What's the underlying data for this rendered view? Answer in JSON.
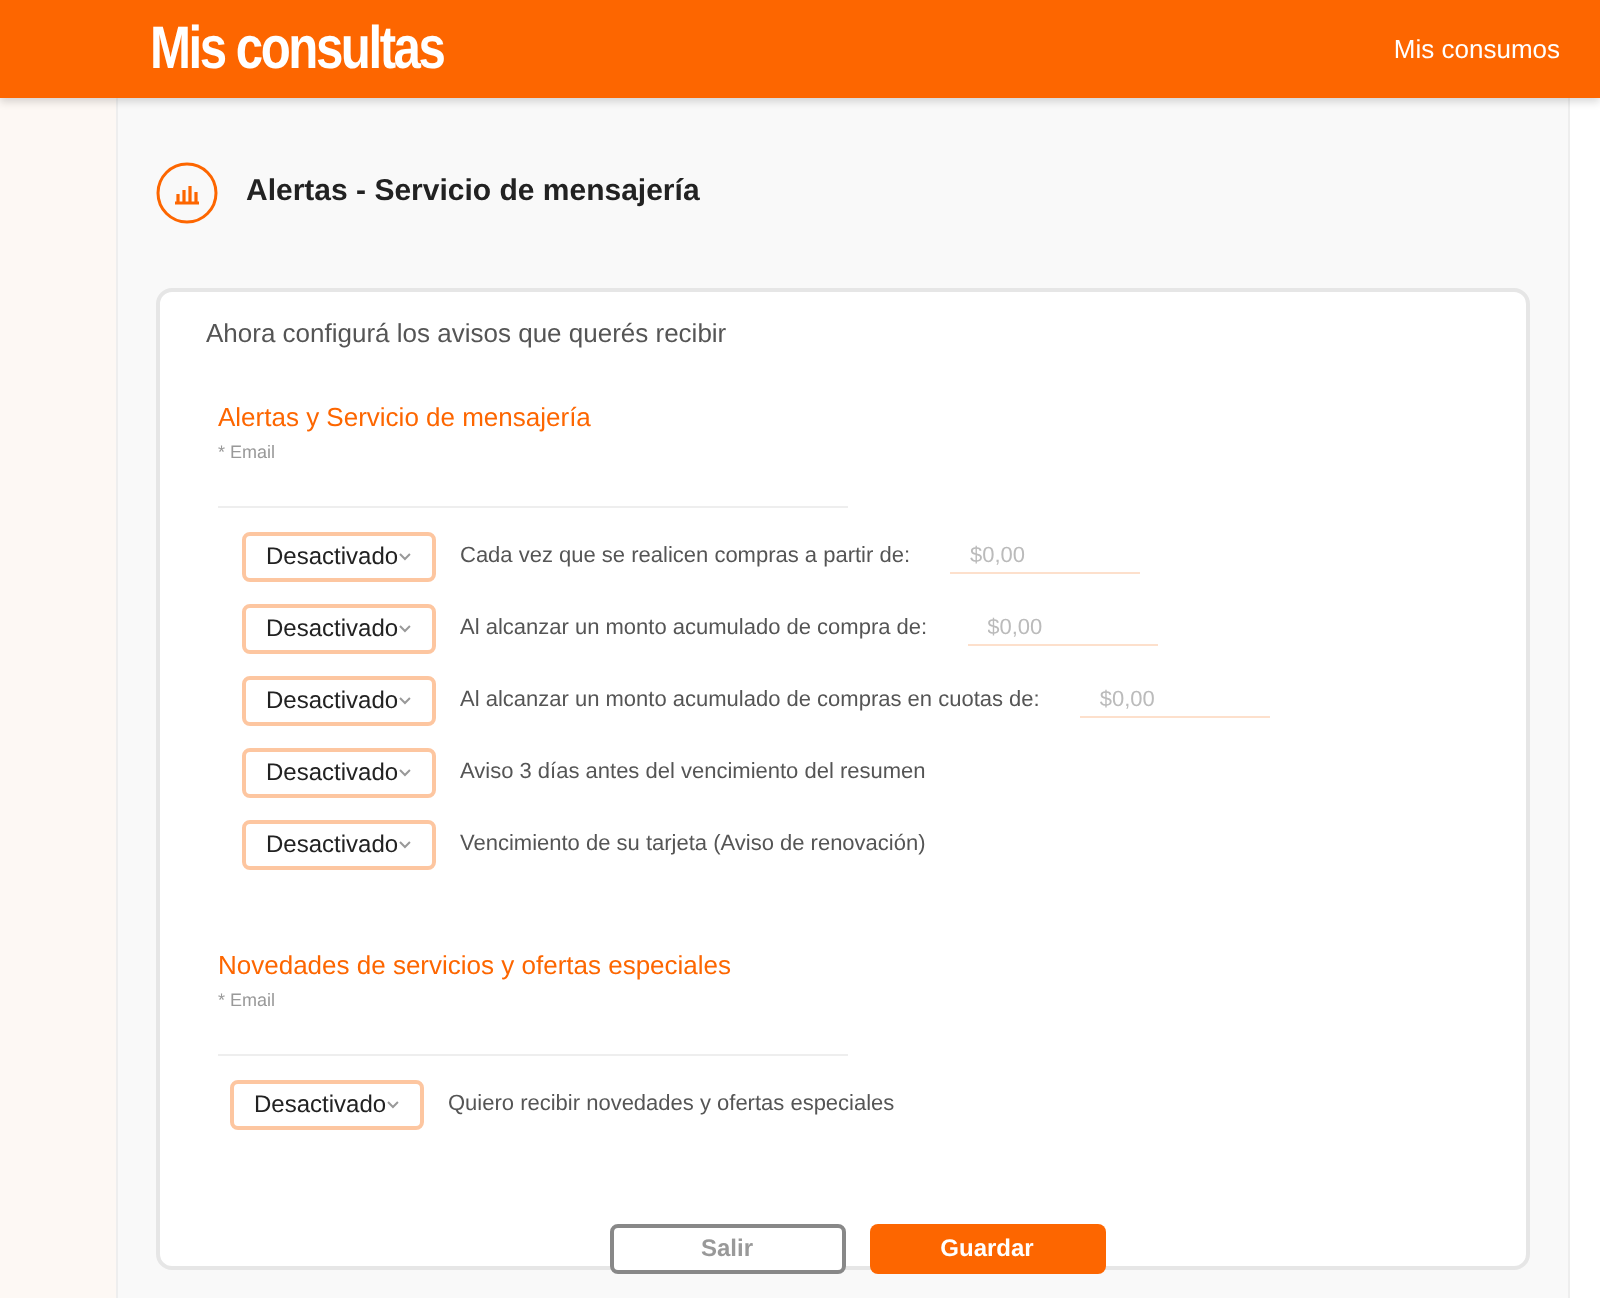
{
  "header": {
    "title": "Mis consultas",
    "link": "Mis consumos"
  },
  "page_title": "Alertas - Servicio de mensajería",
  "intro": "Ahora configurá los avisos que querés recibir",
  "sections": [
    {
      "title": "Alertas y Servicio de mensajería",
      "email_label": "* Email",
      "rows": [
        {
          "kind": "amount",
          "select": "Desactivado",
          "label": "Cada vez que se realicen compras a partir de:",
          "placeholder": "$0,00"
        },
        {
          "kind": "amount",
          "select": "Desactivado",
          "label": "Al alcanzar un monto acumulado de compra de:",
          "placeholder": "$0,00"
        },
        {
          "kind": "amount",
          "select": "Desactivado",
          "label": "Al alcanzar un monto acumulado de compras en cuotas de:",
          "placeholder": "$0,00"
        },
        {
          "kind": "plain",
          "select": "Desactivado",
          "label": "Aviso 3 días antes del vencimiento del resumen"
        },
        {
          "kind": "plain",
          "select": "Desactivado",
          "label": "Vencimiento de su tarjeta (Aviso de renovación)"
        }
      ]
    },
    {
      "title": "Novedades de servicios y ofertas especiales",
      "email_label": "* Email",
      "rows": [
        {
          "kind": "plain",
          "select": "Desactivado",
          "label": "Quiero recibir novedades y ofertas especiales"
        }
      ]
    }
  ],
  "buttons": {
    "cancel": "Salir",
    "save": "Guardar"
  }
}
